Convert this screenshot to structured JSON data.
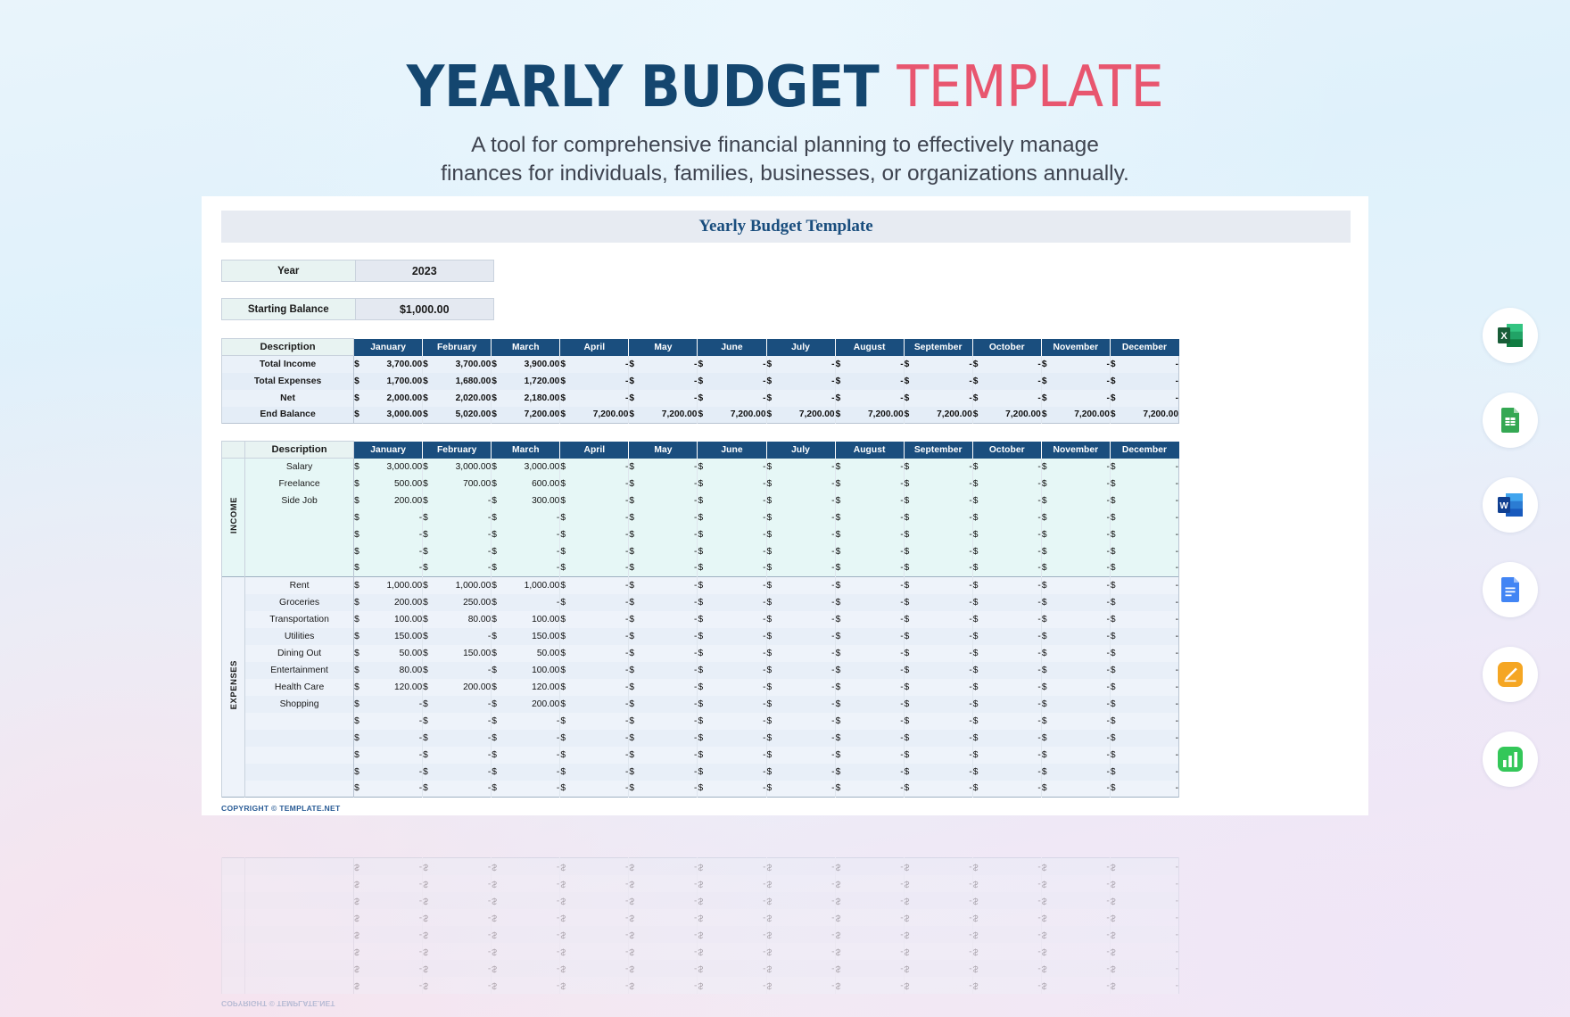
{
  "header": {
    "title_part1": "YEARLY BUDGET",
    "title_part2": "TEMPLATE",
    "subtitle_line1": "A tool for comprehensive financial planning to effectively manage",
    "subtitle_line2": "finances for individuals, families, businesses, or organizations annually.",
    "accent_navy": "#14466f",
    "accent_pink": "#e8566f"
  },
  "sheet": {
    "title": "Yearly Budget Template",
    "meta": [
      {
        "label": "Year",
        "value": "2023"
      },
      {
        "label": "Starting Balance",
        "value": "$1,000.00"
      }
    ],
    "copyright": "COPYRIGHT © TEMPLATE.NET"
  },
  "months": [
    "January",
    "February",
    "March",
    "April",
    "May",
    "June",
    "July",
    "August",
    "September",
    "October",
    "November",
    "December"
  ],
  "description_header": "Description",
  "currency_symbol": "$",
  "blank_value": "-",
  "summary_table": {
    "rows": [
      {
        "label": "Total Income",
        "values": [
          "3,700.00",
          "3,700.00",
          "3,900.00",
          "-",
          "-",
          "-",
          "-",
          "-",
          "-",
          "-",
          "-",
          "-"
        ]
      },
      {
        "label": "Total Expenses",
        "values": [
          "1,700.00",
          "1,680.00",
          "1,720.00",
          "-",
          "-",
          "-",
          "-",
          "-",
          "-",
          "-",
          "-",
          "-"
        ]
      },
      {
        "label": "Net",
        "values": [
          "2,000.00",
          "2,020.00",
          "2,180.00",
          "-",
          "-",
          "-",
          "-",
          "-",
          "-",
          "-",
          "-",
          "-"
        ]
      },
      {
        "label": "End Balance",
        "values": [
          "3,000.00",
          "5,020.00",
          "7,200.00",
          "7,200.00",
          "7,200.00",
          "7,200.00",
          "7,200.00",
          "7,200.00",
          "7,200.00",
          "7,200.00",
          "7,200.00",
          "7,200.00"
        ]
      }
    ]
  },
  "detail_table": {
    "income_label": "INCOME",
    "expenses_label": "EXPENSES",
    "income_rows": [
      {
        "label": "Salary",
        "values": [
          "3,000.00",
          "3,000.00",
          "3,000.00",
          "-",
          "-",
          "-",
          "-",
          "-",
          "-",
          "-",
          "-",
          "-"
        ]
      },
      {
        "label": "Freelance",
        "values": [
          "500.00",
          "700.00",
          "600.00",
          "-",
          "-",
          "-",
          "-",
          "-",
          "-",
          "-",
          "-",
          "-"
        ]
      },
      {
        "label": "Side Job",
        "values": [
          "200.00",
          "-",
          "300.00",
          "-",
          "-",
          "-",
          "-",
          "-",
          "-",
          "-",
          "-",
          "-"
        ]
      },
      {
        "label": "",
        "values": [
          "-",
          "-",
          "-",
          "-",
          "-",
          "-",
          "-",
          "-",
          "-",
          "-",
          "-",
          "-"
        ]
      },
      {
        "label": "",
        "values": [
          "-",
          "-",
          "-",
          "-",
          "-",
          "-",
          "-",
          "-",
          "-",
          "-",
          "-",
          "-"
        ]
      },
      {
        "label": "",
        "values": [
          "-",
          "-",
          "-",
          "-",
          "-",
          "-",
          "-",
          "-",
          "-",
          "-",
          "-",
          "-"
        ]
      },
      {
        "label": "",
        "values": [
          "-",
          "-",
          "-",
          "-",
          "-",
          "-",
          "-",
          "-",
          "-",
          "-",
          "-",
          "-"
        ]
      }
    ],
    "expense_rows": [
      {
        "label": "Rent",
        "values": [
          "1,000.00",
          "1,000.00",
          "1,000.00",
          "-",
          "-",
          "-",
          "-",
          "-",
          "-",
          "-",
          "-",
          "-"
        ]
      },
      {
        "label": "Groceries",
        "values": [
          "200.00",
          "250.00",
          "-",
          "-",
          "-",
          "-",
          "-",
          "-",
          "-",
          "-",
          "-",
          "-"
        ]
      },
      {
        "label": "Transportation",
        "values": [
          "100.00",
          "80.00",
          "100.00",
          "-",
          "-",
          "-",
          "-",
          "-",
          "-",
          "-",
          "-",
          "-"
        ]
      },
      {
        "label": "Utilities",
        "values": [
          "150.00",
          "-",
          "150.00",
          "-",
          "-",
          "-",
          "-",
          "-",
          "-",
          "-",
          "-",
          "-"
        ]
      },
      {
        "label": "Dining Out",
        "values": [
          "50.00",
          "150.00",
          "50.00",
          "-",
          "-",
          "-",
          "-",
          "-",
          "-",
          "-",
          "-",
          "-"
        ]
      },
      {
        "label": "Entertainment",
        "values": [
          "80.00",
          "-",
          "100.00",
          "-",
          "-",
          "-",
          "-",
          "-",
          "-",
          "-",
          "-",
          "-"
        ]
      },
      {
        "label": "Health Care",
        "values": [
          "120.00",
          "200.00",
          "120.00",
          "-",
          "-",
          "-",
          "-",
          "-",
          "-",
          "-",
          "-",
          "-"
        ]
      },
      {
        "label": "Shopping",
        "values": [
          "-",
          "-",
          "200.00",
          "-",
          "-",
          "-",
          "-",
          "-",
          "-",
          "-",
          "-",
          "-"
        ]
      },
      {
        "label": "",
        "values": [
          "-",
          "-",
          "-",
          "-",
          "-",
          "-",
          "-",
          "-",
          "-",
          "-",
          "-",
          "-"
        ]
      },
      {
        "label": "",
        "values": [
          "-",
          "-",
          "-",
          "-",
          "-",
          "-",
          "-",
          "-",
          "-",
          "-",
          "-",
          "-"
        ]
      },
      {
        "label": "",
        "values": [
          "-",
          "-",
          "-",
          "-",
          "-",
          "-",
          "-",
          "-",
          "-",
          "-",
          "-",
          "-"
        ]
      },
      {
        "label": "",
        "values": [
          "-",
          "-",
          "-",
          "-",
          "-",
          "-",
          "-",
          "-",
          "-",
          "-",
          "-",
          "-"
        ]
      },
      {
        "label": "",
        "values": [
          "-",
          "-",
          "-",
          "-",
          "-",
          "-",
          "-",
          "-",
          "-",
          "-",
          "-",
          "-"
        ]
      }
    ]
  },
  "icon_rail": {
    "items": [
      {
        "name": "microsoft-excel-icon",
        "title": "Excel",
        "color": "#1d8a4e"
      },
      {
        "name": "google-sheets-icon",
        "title": "Google Sheets",
        "color": "#34a853"
      },
      {
        "name": "microsoft-word-icon",
        "title": "Word",
        "color": "#2b579a"
      },
      {
        "name": "google-docs-icon",
        "title": "Google Docs",
        "color": "#4285f4"
      },
      {
        "name": "apple-pages-icon",
        "title": "Apple Pages",
        "color": "#f5a623"
      },
      {
        "name": "apple-numbers-icon",
        "title": "Apple Numbers",
        "color": "#34c759"
      }
    ]
  }
}
